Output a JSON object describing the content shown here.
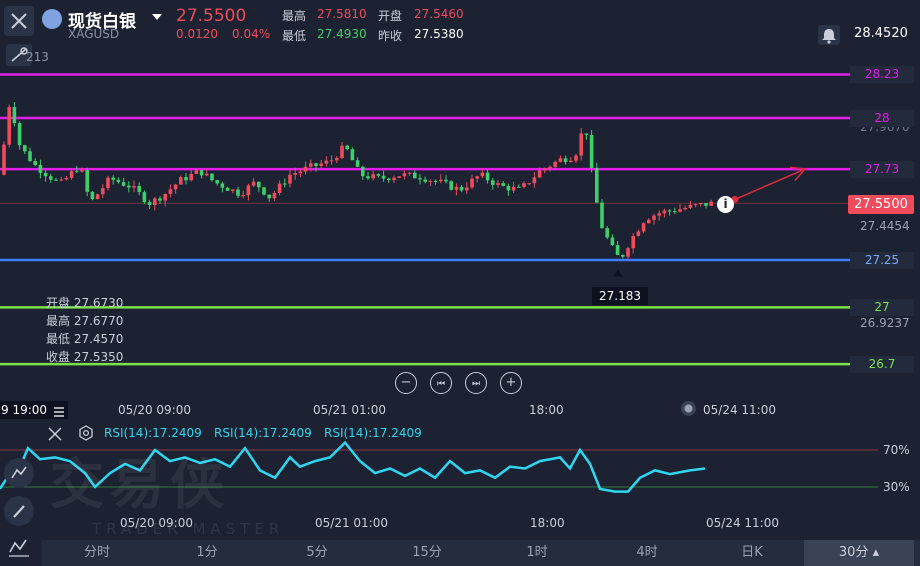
{
  "header": {
    "title": "现货白银",
    "symbol": "XAGUSD",
    "price": "27.5500",
    "change": "0.0120",
    "change_pct": "0.04%",
    "high_label": "最高",
    "high": "27.5810",
    "open_label": "开盘",
    "open": "27.5460",
    "low_label": "最低",
    "low": "27.4930",
    "prev_close_label": "昨收",
    "prev_close": "27.5380",
    "top_value": "28.4520"
  },
  "main_chart": {
    "left_axis_value": "213",
    "levels": [
      {
        "label": "28.23",
        "value": 28.23,
        "color": "#e21ee8"
      },
      {
        "label": "28",
        "value": 28.0,
        "color": "#e21ee8"
      },
      {
        "label": "27.73",
        "value": 27.73,
        "color": "#e21ee8"
      },
      {
        "label": "27.25",
        "value": 27.25,
        "color": "#3c7dff"
      },
      {
        "label": "27",
        "value": 27.0,
        "color": "#7be34a"
      },
      {
        "label": "26.7",
        "value": 26.7,
        "color": "#7be34a"
      }
    ],
    "axis_labels": [
      "27.9670",
      "27.4454",
      "26.9237"
    ],
    "current_price_tag": "27.5500",
    "low_marker": "27.183",
    "ohlc": {
      "open": "开盘 27.6730",
      "high": "最高 27.6770",
      "low": "最低 27.4570",
      "close": "收盘 27.5350"
    }
  },
  "time_axis": {
    "cursor_label": "9 19:00",
    "labels": [
      "05/20 09:00",
      "05/21 01:00",
      "18:00",
      "05/24 11:00"
    ]
  },
  "rsi": {
    "labels": [
      "RSI(14):17.2409",
      "RSI(14):17.2409",
      "RSI(14):17.2409"
    ],
    "levels": [
      "70%",
      "30%"
    ],
    "time_labels": [
      "05/20 09:00",
      "05/21 01:00",
      "18:00",
      "05/24 11:00"
    ]
  },
  "watermark": {
    "text": "交易侠",
    "subtext": "TRADER MASTER"
  },
  "tabs": [
    "分时",
    "1分",
    "5分",
    "15分",
    "1时",
    "4时",
    "日K",
    "30分"
  ],
  "active_tab": "30分",
  "colors": {
    "up": "#f04b5a",
    "down": "#3dcf6a",
    "rsi": "#2fd6f0",
    "bg": "#1c2232"
  }
}
